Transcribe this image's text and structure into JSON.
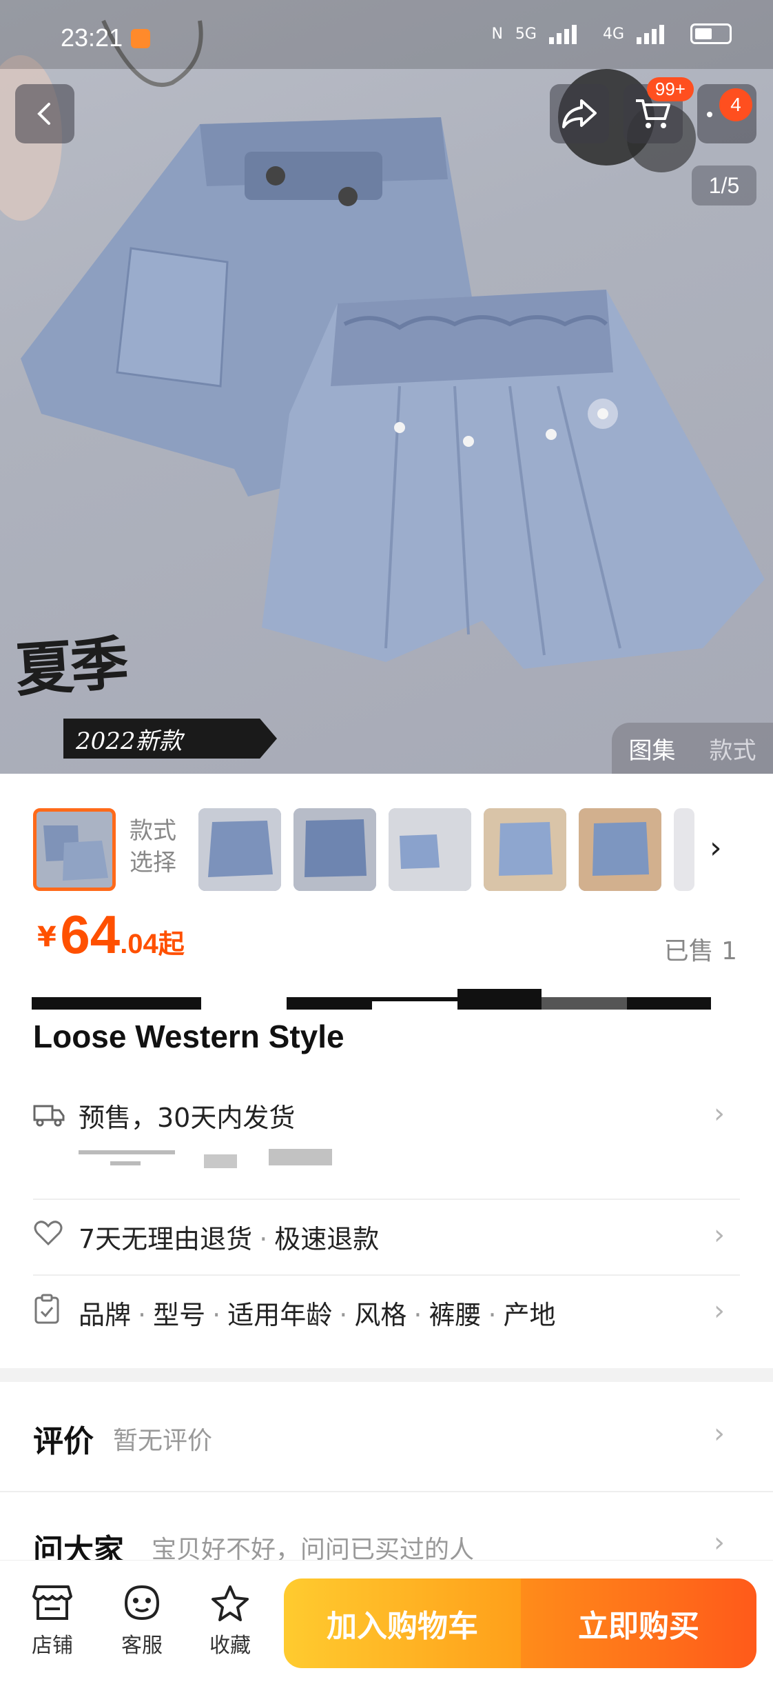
{
  "status_bar": {
    "time": "23:21",
    "network_5g": "5G",
    "network_4g": "4G"
  },
  "header": {
    "cart_badge": "99+",
    "more_badge": "4",
    "page_indicator": "1/5"
  },
  "hero": {
    "overlay_text_title": "夏季",
    "overlay_text_year": "2022新款",
    "gallery_tabs": [
      "图集",
      "款式"
    ]
  },
  "variants": {
    "label_line1": "款式",
    "label_line2": "选择"
  },
  "price": {
    "currency": "¥",
    "integer": "64",
    "decimal": ".04",
    "suffix": "起"
  },
  "sold": "已售 1",
  "title": "Loose Western Style",
  "shipping": {
    "text": "预售，30天内发货"
  },
  "services": [
    "7天无理由退货",
    "极速退款"
  ],
  "params": [
    "品牌",
    "型号",
    "适用年龄",
    "风格",
    "裤腰",
    "产地"
  ],
  "reviews": {
    "title": "评价",
    "subtitle": "暂无评价"
  },
  "qa": {
    "title": "问大家",
    "subtitle": "宝贝好不好，问问已买过的人"
  },
  "bottom_bar": {
    "store": "店铺",
    "service": "客服",
    "favorite": "收藏",
    "add_to_cart": "加入购物车",
    "buy_now": "立即购买"
  },
  "colors": {
    "accent": "#ff5000",
    "cart_button": "#ffb21f",
    "buy_button": "#ff6a1a"
  }
}
